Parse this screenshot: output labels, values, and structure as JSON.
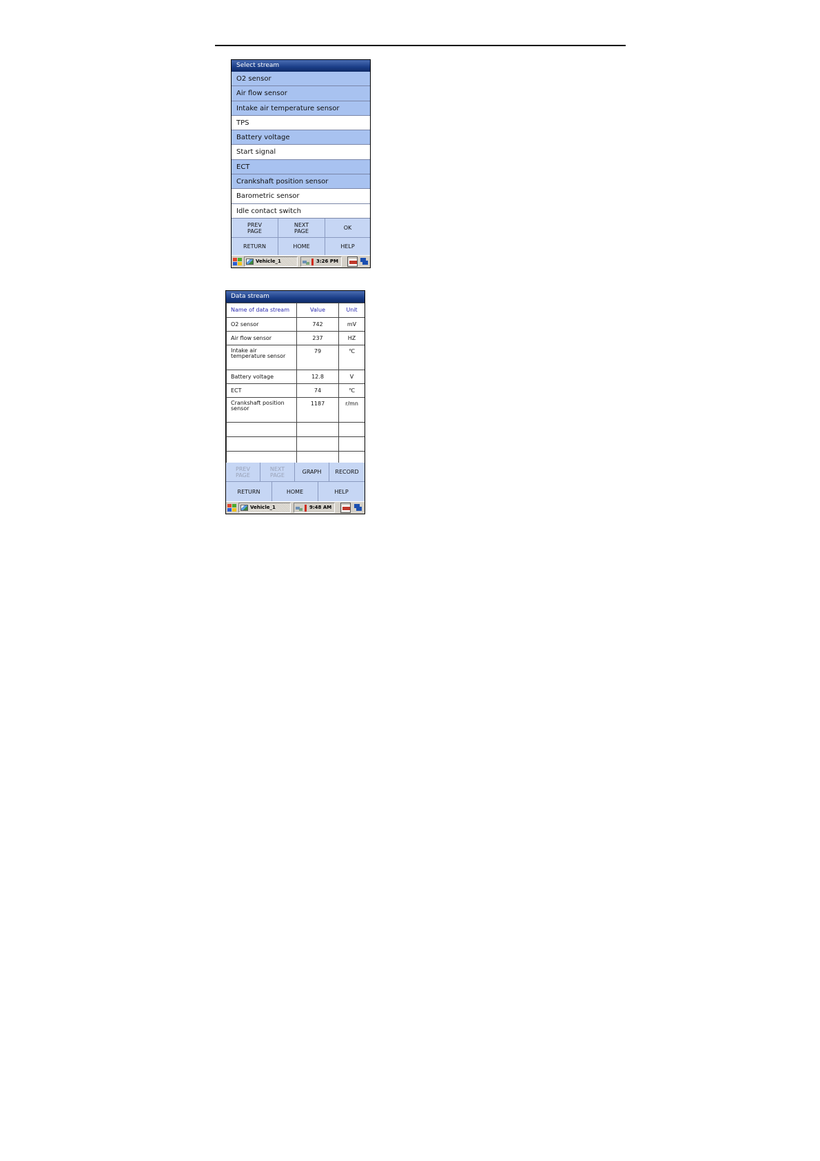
{
  "select_screen": {
    "title": "Select stream",
    "items": [
      {
        "label": "O2 sensor",
        "selected": true
      },
      {
        "label": "Air flow sensor",
        "selected": true
      },
      {
        "label": "Intake air temperature sensor",
        "selected": true
      },
      {
        "label": "TPS",
        "selected": false
      },
      {
        "label": "Battery voltage",
        "selected": true
      },
      {
        "label": "Start signal",
        "selected": false
      },
      {
        "label": "ECT",
        "selected": true
      },
      {
        "label": "Crankshaft position sensor",
        "selected": true
      },
      {
        "label": "Barometric sensor",
        "selected": false
      },
      {
        "label": "Idle contact switch",
        "selected": false
      }
    ],
    "buttons": {
      "prev": "PREV\nPAGE",
      "next": "NEXT\nPAGE",
      "ok": "OK",
      "return": "RETURN",
      "home": "HOME",
      "help": "HELP"
    },
    "taskbar": {
      "task": "Vehicle_1",
      "time": "3:26 PM"
    }
  },
  "data_screen": {
    "title": "Data stream",
    "headers": {
      "name": "Name of data stream",
      "value": "Value",
      "unit": "Unit"
    },
    "rows": [
      {
        "name": "O2 sensor",
        "value": "742",
        "unit": "mV"
      },
      {
        "name": "Air flow sensor",
        "value": "237",
        "unit": "HZ"
      },
      {
        "name": "Intake air\ntemperature sensor",
        "value": "79",
        "unit": "℃"
      },
      {
        "name": "Battery voltage",
        "value": "12.8",
        "unit": "V"
      },
      {
        "name": "ECT",
        "value": "74",
        "unit": "℃"
      },
      {
        "name": "Crankshaft position\nsensor",
        "value": "1187",
        "unit": "r/mn"
      }
    ],
    "buttons": {
      "prev": "PREV\nPAGE",
      "next": "NEXT\nPAGE",
      "graph": "GRAPH",
      "record": "RECORD",
      "return": "RETURN",
      "home": "HOME",
      "help": "HELP"
    },
    "taskbar": {
      "task": "Vehicle_1",
      "time": "9:48 AM"
    }
  },
  "colors": {
    "selected_row": "#a8c2f0",
    "button_bg": "#c6d6f4",
    "titlebar": "#1b3e88",
    "header_text": "#2a2ab0"
  }
}
